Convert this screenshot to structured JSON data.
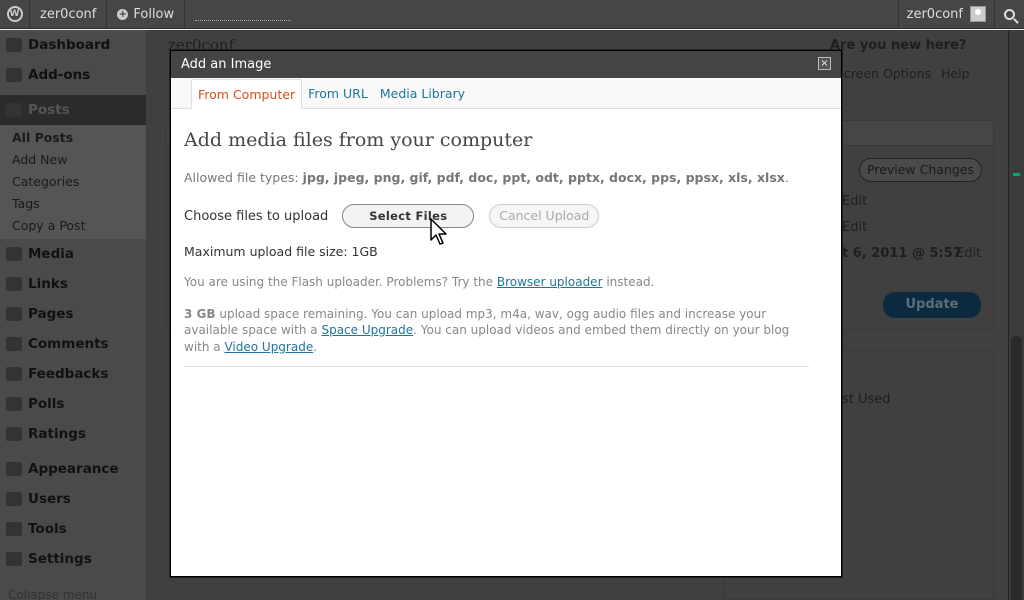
{
  "adminbar": {
    "site_name": "zer0conf",
    "follow_label": "Follow",
    "user_name": "zer0conf"
  },
  "menu": {
    "items": [
      {
        "label": "Dashboard"
      },
      {
        "label": "Add-ons"
      },
      {
        "label": "Posts"
      },
      {
        "label": "Media"
      },
      {
        "label": "Links"
      },
      {
        "label": "Pages"
      },
      {
        "label": "Comments"
      },
      {
        "label": "Feedbacks"
      },
      {
        "label": "Polls"
      },
      {
        "label": "Ratings"
      },
      {
        "label": "Appearance"
      },
      {
        "label": "Users"
      },
      {
        "label": "Tools"
      },
      {
        "label": "Settings"
      }
    ],
    "posts_submenu": [
      "All Posts",
      "Add New",
      "Categories",
      "Tags",
      "Copy a Post"
    ],
    "collapse_label": "Collapse menu"
  },
  "background": {
    "page_header": "zer0conf",
    "new_here": "Are you new here?",
    "screen_options": "Screen Options",
    "help": "Help",
    "preview_changes": "Preview Changes",
    "edit_1": "Edit",
    "edit_2": "Edit",
    "published_date": "t 6, 2011 @ 5:57",
    "edit_3": "Edit",
    "update": "Update",
    "most_used": "ost Used"
  },
  "modal": {
    "title": "Add an Image",
    "close_symbol": "×",
    "tabs": [
      "From Computer",
      "From URL",
      "Media Library"
    ],
    "heading": "Add media files from your computer",
    "allowed_prefix": "Allowed file types:",
    "allowed_types": "jpg, jpeg, png, gif, pdf, doc, ppt, odt, pptx, docx, pps, ppsx, xls, xlsx",
    "allowed_suffix": ".",
    "choose_label": "Choose files to upload",
    "select_files": "Select Files",
    "cancel_upload": "Cancel Upload",
    "max_size": "Maximum upload file size: 1GB",
    "flash_prefix": "You are using the Flash uploader. Problems? Try the",
    "browser_uploader": "Browser uploader",
    "flash_suffix": "instead.",
    "space_amount": "3 GB",
    "space_text_1": "upload space remaining. You can upload mp3, m4a, wav, ogg audio files and increase your available space with a",
    "space_upgrade": "Space Upgrade",
    "space_text_2": ". You can upload videos and embed them directly on your blog with a",
    "video_upgrade": "Video Upgrade",
    "space_end": "."
  }
}
